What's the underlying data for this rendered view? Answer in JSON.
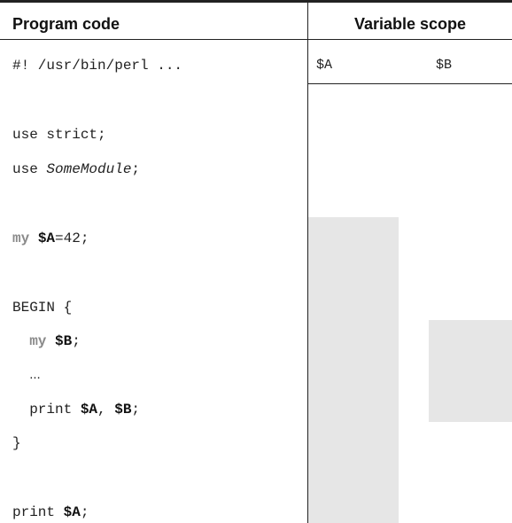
{
  "header": {
    "left": "Program code",
    "right": "Variable scope"
  },
  "scope_columns": [
    "$A",
    "$B"
  ],
  "code": {
    "line1": "#! /usr/bin/perl ...",
    "use_strict": "use strict;",
    "use_kw": "use ",
    "use_module": "SomeModule",
    "semicolon": ";",
    "my": "my",
    "var_a": "$A",
    "assign": "=42;",
    "begin": "BEGIN {",
    "var_b": "$B",
    "ellipsis": "...",
    "print": "print ",
    "comma": ", ",
    "close_brace": "}"
  }
}
